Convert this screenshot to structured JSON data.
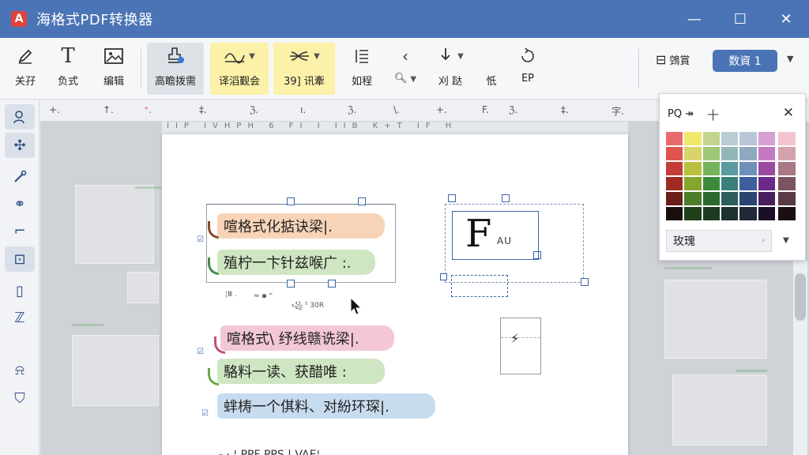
{
  "app": {
    "title": "海格式PDF转换器",
    "icon_letter": "A"
  },
  "window": {
    "minimize": "—",
    "maximize": "☐",
    "close": "✕"
  },
  "ribbon": {
    "buttons": [
      {
        "label": "关孖",
        "icon": "pen-icon"
      },
      {
        "label": "负式",
        "icon": "text-icon"
      },
      {
        "label": "编辑",
        "icon": "image-icon"
      },
      {
        "label": "高瞻拨需",
        "icon": "stamp-icon"
      },
      {
        "label": "译滔觐会",
        "icon": "highlight-wave-icon"
      },
      {
        "label": "39] 讯牽",
        "icon": "strike-icon"
      },
      {
        "label": "如程",
        "icon": "list-icon"
      },
      {
        "label": "",
        "icon": "chevron-left-icon"
      },
      {
        "label": "刈 跶",
        "icon": "download-icon"
      },
      {
        "label": "忯",
        "icon": ""
      },
      {
        "label": "EP",
        "icon": "rotate-icon"
      }
    ],
    "share_label": "鵼賞",
    "pill_label": "数資 1"
  },
  "ruler_marks": [
    "+.",
    "↑.",
    "⁺.",
    "‡.",
    "ℨ.",
    "ı.",
    "ℨ.",
    "\\.",
    "+.",
    "F.",
    "ℨ.",
    "‡.",
    "字."
  ],
  "ruler2_text": "IIP IVHPH 6 FI I IIB K+T IF H",
  "notes": [
    {
      "text": "喧格式化掂诀梁|.",
      "color": "orange"
    },
    {
      "text": "殖柠一卞针兹喉广 :.",
      "color": "green"
    },
    {
      "text": "喧格式\\ 纾线赣诜梁|.",
      "color": "pink"
    },
    {
      "text": "駱料一读、获醋唯 :",
      "color": "green"
    },
    {
      "text": "蝆梼一个倛料、对紛环琛|.",
      "color": "blue"
    }
  ],
  "textbox": {
    "big": "F",
    "sub": "AU"
  },
  "tiny_labels": [
    "¦Ⅲ .",
    "≈ ▪ ⁼",
    "꧁ ⁵ 30R"
  ],
  "bottom_text": "- · ¦ PPF PPS | VAE¦",
  "panel": {
    "title": "PQ ↠",
    "plus": "十",
    "close": "✕",
    "select_value": "玫瑰",
    "palette": [
      [
        "#e96a6a",
        "#f2e86a",
        "#c2d48f",
        "#b9ccd4",
        "#b9c6d8",
        "#d6a0d4"
      ],
      [
        "#e0544e",
        "#d8d46a",
        "#9fc776",
        "#92b7b8",
        "#8ea9c0",
        "#c47ac2"
      ],
      [
        "#c43c36",
        "#b9bf3f",
        "#74b35a",
        "#5b9aa0",
        "#6f90b8",
        "#9a4aa0"
      ],
      [
        "#9e2a24",
        "#86a62d",
        "#3e8a3c",
        "#3b7f7d",
        "#3c5f9e",
        "#6e2a8a"
      ],
      [
        "#6a1e1a",
        "#4f7e2a",
        "#2a6a2e",
        "#2d5e5c",
        "#2c4470",
        "#4a1f60"
      ],
      [
        "#1a0e0c",
        "#1f4018",
        "#1d3b22",
        "#1d3030",
        "#20283a",
        "#1a0f24"
      ]
    ],
    "palette_extra": [
      "#f2c4cf",
      "#d4a2ad",
      "#a87884",
      "#7c5460",
      "#5a3a44",
      "#1a1014"
    ]
  }
}
